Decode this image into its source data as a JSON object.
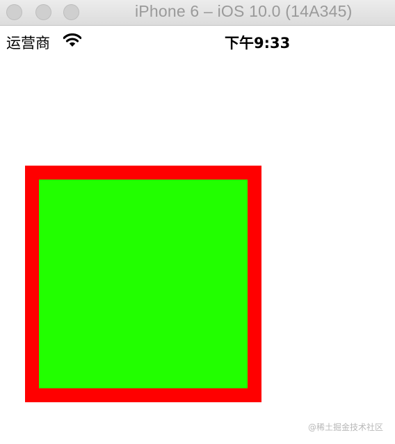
{
  "window": {
    "title": "iPhone 6 – iOS 10.0 (14A345)"
  },
  "status_bar": {
    "carrier": "运营商",
    "wifi_icon": "wifi-icon",
    "time": "下午9:33"
  },
  "content": {
    "outer_color": "#ff0000",
    "inner_color": "#22ff00"
  },
  "watermark": "@稀土掘金技术社区"
}
